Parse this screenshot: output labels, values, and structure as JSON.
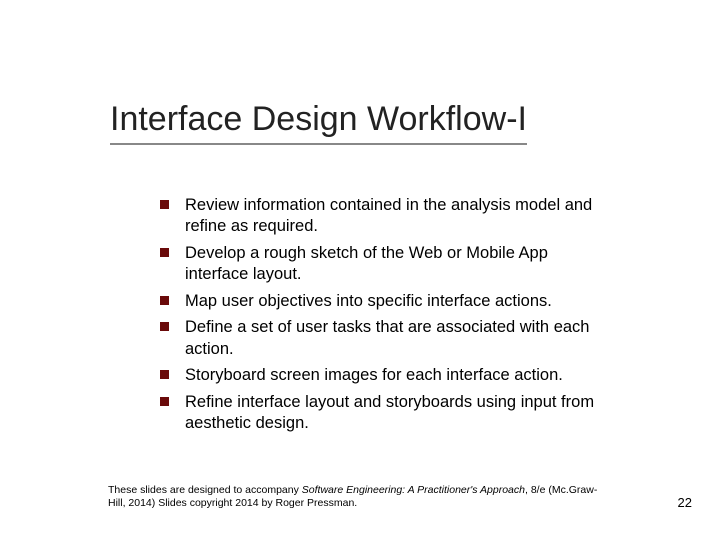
{
  "title": "Interface Design Workflow-I",
  "bullets": [
    "Review information contained in the analysis model and refine as required.",
    "Develop a rough sketch of the Web or Mobile App interface layout.",
    "Map user objectives into specific interface actions.",
    "Define a set of user tasks that are associated with each action.",
    "Storyboard screen images for each interface action.",
    "Refine interface layout and storyboards using input from aesthetic design."
  ],
  "footer": {
    "prefix": "These slides are designed to accompany ",
    "book_title": "Software Engineering: A Practitioner's Approach",
    "suffix": ", 8/e (Mc.Graw-Hill, 2014) Slides copyright 2014 by Roger Pressman."
  },
  "page_number": "22"
}
